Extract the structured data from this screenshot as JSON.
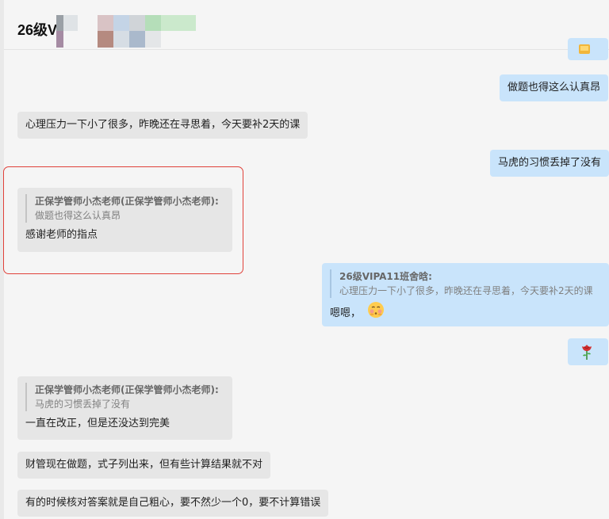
{
  "header": {
    "title": "26级V"
  },
  "messages": [
    {
      "side": "out",
      "kind": "text",
      "text": "做题也得这么认真昂"
    },
    {
      "side": "in",
      "kind": "text",
      "text": "心理压力一下小了很多，昨晚还在寻思着，今天要补2天的课"
    },
    {
      "side": "out",
      "kind": "text",
      "text": "马虎的习惯丢掉了没有"
    },
    {
      "side": "in",
      "kind": "quote",
      "quote_sender": "正保学管师小杰老师(正保学管师小杰老师):",
      "quote_text": "做题也得这么认真昂",
      "text": "感谢老师的指点"
    },
    {
      "side": "out",
      "kind": "quote",
      "quote_sender": "26级VIPA11班舍晗:",
      "quote_text": "心理压力一下小了很多，昨晚还在寻思着，今天要补2天的课",
      "text": "嗯嗯，"
    },
    {
      "side": "out",
      "kind": "emoji",
      "emoji": "rose-emoji"
    },
    {
      "side": "in",
      "kind": "quote",
      "quote_sender": "正保学管师小杰老师(正保学管师小杰老师):",
      "quote_text": "马虎的习惯丢掉了没有",
      "text": "一直在改正，但是还没达到完美"
    },
    {
      "side": "in",
      "kind": "text",
      "text": "财管现在做题，式子列出来，但有些计算结果就不对"
    },
    {
      "side": "in",
      "kind": "text",
      "text": "有的时候核对答案就是自己粗心，要不然少一个0，要不计算错误"
    }
  ],
  "colors": {
    "incoming_bubble": "#e6e6e6",
    "outgoing_bubble": "#c9e4fb",
    "highlight": "#e0413a",
    "background": "#f5f5f5"
  }
}
